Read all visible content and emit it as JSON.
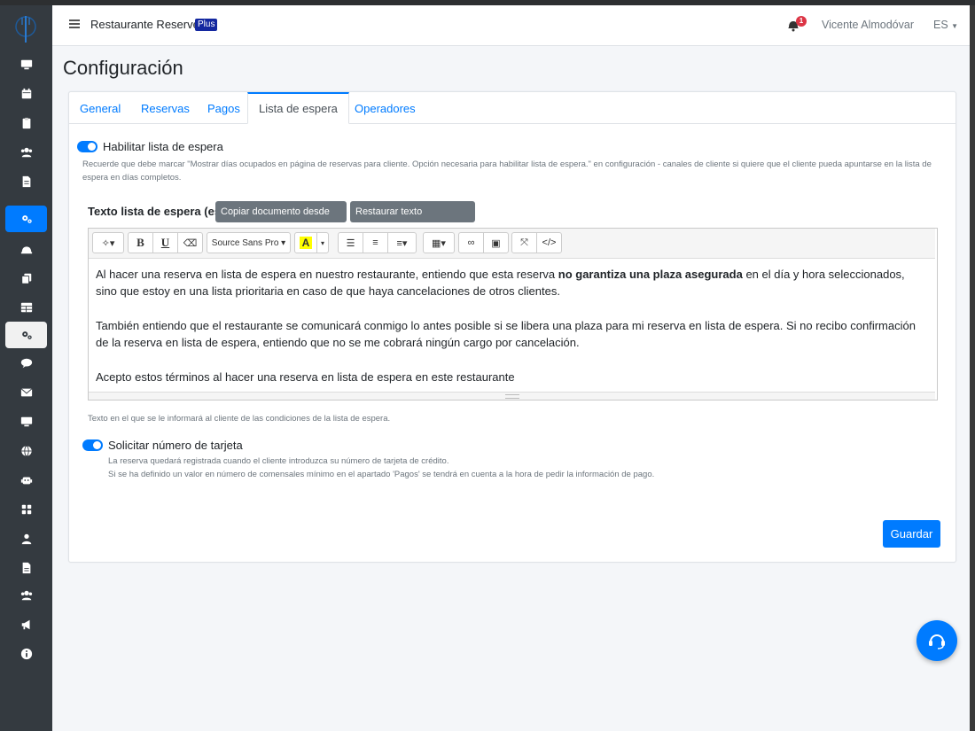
{
  "navbar": {
    "brand": "Restaurante Reserver",
    "brand_badge": "Plus",
    "notification_count": "1",
    "user_name": "Vicente Almodóvar",
    "language": "ES"
  },
  "sidebar": {
    "icons": [
      "monitor-icon",
      "calendar-icon",
      "clipboard-icon",
      "users-icon",
      "file-icon",
      "cogs-icon",
      "bell-icon",
      "copy-icon",
      "table-icon",
      "cogs-icon",
      "comment-icon",
      "envelope-icon",
      "desktop-icon",
      "globe-icon",
      "robot-icon",
      "grid-icon",
      "user-icon",
      "document-icon",
      "group-icon",
      "megaphone-icon",
      "info-icon"
    ],
    "active_index": 5,
    "highlight_index": 9
  },
  "page": {
    "title": "Configuración"
  },
  "tabs": [
    {
      "label": "General"
    },
    {
      "label": "Reservas"
    },
    {
      "label": "Pagos"
    },
    {
      "label": "Lista de espera"
    },
    {
      "label": "Operadores"
    }
  ],
  "waitlist": {
    "enable_label": "Habilitar lista de espera",
    "enable_help_1": "Recuerde que debe marcar \"Mostrar días ocupados en página de reservas para cliente. Opción necesaria para habilitar lista de espera.\" en configuración - canales de cliente si quiere que el cliente pueda apuntarse en la lista de",
    "enable_help_2": "espera en días completos.",
    "text_label": "Texto lista de espera (es)",
    "copy_button": "Copiar documento desde EN",
    "restore_button": "Restaurar texto predefinido",
    "editor": {
      "font_name": "Source Sans Pro",
      "p1_before": "Al hacer una reserva en lista de espera en nuestro restaurante, entiendo que esta reserva ",
      "p1_bold": "no garantiza una plaza asegurada",
      "p1_after": " en el día y hora seleccionados, sino que estoy en una lista prioritaria en caso de que haya cancelaciones de otros clientes.",
      "p2": "También entiendo que el restaurante se comunicará conmigo lo antes posible si se libera una plaza para mi reserva en lista de espera. Si no recibo confirmación de la reserva en lista de espera, entiendo que no se me cobrará ningún cargo por cancelación.",
      "p3": "Acepto estos términos al hacer una reserva en lista de espera en este restaurante"
    },
    "text_help": "Texto en el que se le informará al cliente de las condiciones de la lista de espera.",
    "card_label": "Solicitar número de tarjeta",
    "card_help_1": "La reserva quedará registrada cuando el cliente introduzca su número de tarjeta de crédito.",
    "card_help_2": "Si se ha definido un valor en número de comensales mínimo en el apartado 'Pagos' se tendrá en cuenta a la hora de pedir la información de pago.",
    "enable_waitlist": true,
    "request_card": true
  },
  "actions": {
    "save": "Guardar"
  },
  "colors": {
    "primary": "#007bff",
    "sidebar": "#343a40",
    "badge": "#1428a0"
  }
}
